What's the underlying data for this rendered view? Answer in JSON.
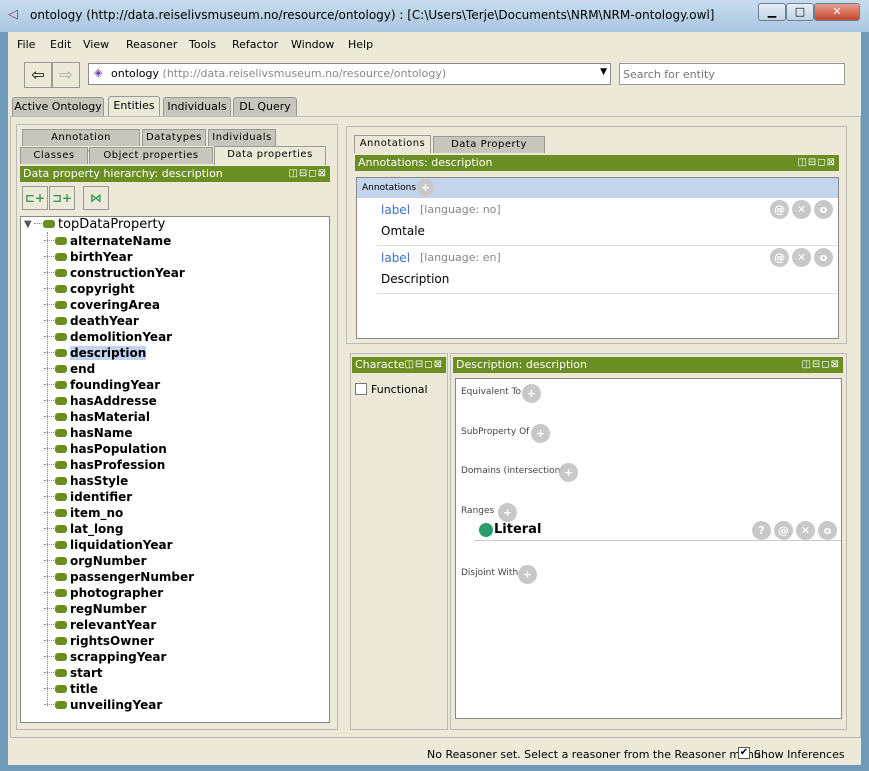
{
  "window": {
    "title": "ontology (http://data.reiselivsmuseum.no/resource/ontology)  : [C:\\Users\\Terje\\Documents\\NRM\\NRM-ontology.owl]",
    "minimize": "▁",
    "maximize": "□",
    "close": "✕"
  },
  "menu": [
    "File",
    "Edit",
    "View",
    "Reasoner",
    "Tools",
    "Refactor",
    "Window",
    "Help"
  ],
  "toolbar": {
    "back": "⇦",
    "forward": "⇨",
    "ontology_name": "ontology",
    "ontology_iri": "(http://data.reiselivsmuseum.no/resource/ontology)",
    "search_placeholder": "Search for entity"
  },
  "main_tabs": [
    "Active Ontology",
    "Entities",
    "Individuals",
    "DL Query"
  ],
  "left": {
    "tabs_row1": [
      "Annotation properties",
      "Datatypes",
      "Individuals"
    ],
    "tabs_row2": [
      "Classes",
      "Object properties",
      "Data properties"
    ],
    "header": "Data property hierarchy: description",
    "root": "topDataProperty",
    "items": [
      "alternateName",
      "birthYear",
      "constructionYear",
      "copyright",
      "coveringArea",
      "deathYear",
      "demolitionYear",
      "description",
      "end",
      "foundingYear",
      "hasAddresse",
      "hasMaterial",
      "hasName",
      "hasPopulation",
      "hasProfession",
      "hasStyle",
      "identifier",
      "item_no",
      "lat_long",
      "liquidationYear",
      "orgNumber",
      "passengerNumber",
      "photographer",
      "regNumber",
      "relevantYear",
      "rightsOwner",
      "scrappingYear",
      "start",
      "title",
      "unveilingYear"
    ],
    "selected": "description"
  },
  "annotations": {
    "tabs": [
      "Annotations",
      "Data Property Usage"
    ],
    "header": "Annotations: description",
    "section": "Annotations",
    "entries": [
      {
        "property": "label",
        "lang": "[language: no]",
        "value": "Omtale"
      },
      {
        "property": "label",
        "lang": "[language: en]",
        "value": "Description"
      }
    ]
  },
  "characteristics": {
    "header": "Characteristics",
    "functional_label": "Functional",
    "functional_checked": false
  },
  "description": {
    "header": "Description: description",
    "sections": [
      "Equivalent To",
      "SubProperty Of",
      "Domains (intersection)",
      "Ranges",
      "Disjoint With"
    ],
    "range_value": "Literal"
  },
  "status": {
    "message": "No Reasoner set. Select a reasoner from the Reasoner menu",
    "show_inferences": "Show Inferences",
    "show_inferences_checked": true
  },
  "colors": {
    "header_green": "#6b8e23",
    "label_blue": "#3d6fc4",
    "selection": "#c4d4ee",
    "literal_dot": "#2a9d6a"
  }
}
